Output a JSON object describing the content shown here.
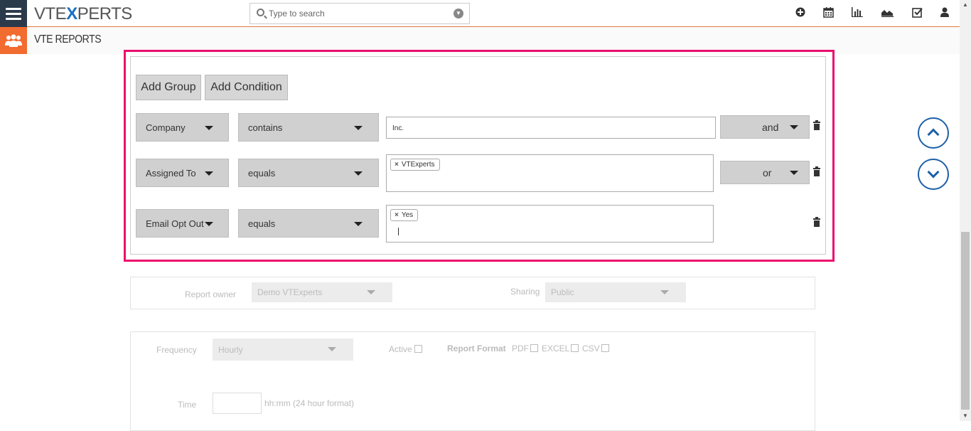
{
  "header": {
    "logo_prefix": "VTE",
    "logo_x": "X",
    "logo_suffix": "PERTS",
    "search_placeholder": "Type to search",
    "icons": [
      "plus-circle-icon",
      "calendar-icon",
      "bar-chart-icon",
      "area-chart-icon",
      "checkbox-icon",
      "user-icon"
    ]
  },
  "module": {
    "title": "VTE REPORTS"
  },
  "conditions": {
    "add_group_label": "Add Group",
    "add_condition_label": "Add Condition",
    "rows": [
      {
        "field": "Company",
        "operator": "contains",
        "value": "Inc.",
        "joiner": "and"
      },
      {
        "field": "Assigned To",
        "operator": "equals",
        "chip": "VTExperts",
        "joiner": "or"
      },
      {
        "field": "Email Opt Out",
        "operator": "equals",
        "chip": "Yes",
        "joiner": ""
      }
    ]
  },
  "sharing_panel": {
    "owner_label": "Report owner",
    "owner_value": "Demo VTExperts",
    "sharing_label": "Sharing",
    "sharing_value": "Public"
  },
  "schedule_panel": {
    "frequency_label": "Frequency",
    "frequency_value": "Hourly",
    "active_label": "Active",
    "format_label": "Report Format",
    "formats": [
      "PDF",
      "EXCEL",
      "CSV"
    ],
    "time_label": "Time",
    "time_hint": "hh:mm (24 hour format)"
  },
  "colors": {
    "highlight": "#ec0e6f",
    "brand_orange": "#f26b2f",
    "nav_dark": "#2b3a4a",
    "accent_blue": "#1d5fa8"
  }
}
